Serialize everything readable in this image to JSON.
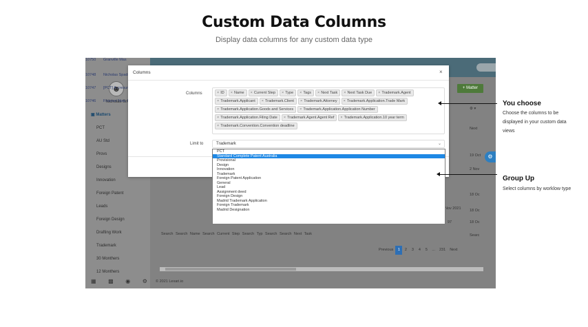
{
  "hero": {
    "title": "Custom Data Columns",
    "subtitle": "Display data columns for any custom data type"
  },
  "app": {
    "user_name": "Nicholas Smi",
    "sidebar": {
      "items": [
        {
          "label": "Matters",
          "active": true
        },
        {
          "label": "PCT"
        },
        {
          "label": "AU Std"
        },
        {
          "label": "Provs"
        },
        {
          "label": "Designs"
        },
        {
          "label": "Innovation"
        },
        {
          "label": "Foreign Patent"
        },
        {
          "label": "Leads"
        },
        {
          "label": "Foreign Design"
        },
        {
          "label": "Drafting Work"
        },
        {
          "label": "Trademark"
        },
        {
          "label": "30 Monthers"
        },
        {
          "label": "12 Monthers"
        }
      ]
    },
    "matter_button": "+ Matter",
    "right_column": [
      "⚙ ▾",
      "Next",
      "19 Oct",
      "2 Nov",
      "18 Oc",
      "Nov 2021",
      "18 Oc",
      "97",
      "18 Oc",
      "Searc"
    ],
    "table_rows": [
      {
        "id": "10750",
        "name": "Granville Mas"
      },
      {
        "id": "10748",
        "name": "Nicholas Spadre"
      },
      {
        "id": "10747",
        "name": "[PCT] A-cresum"
      },
      {
        "id": "10746",
        "name": "Finance Now, Pu"
      }
    ],
    "search_row": "Search    Search Name                                                                    Search Current Step    Search Typ    Search    Search Next Task",
    "pagination": [
      "Previous",
      "1",
      "2",
      "3",
      "4",
      "5",
      "...",
      "231",
      "Next"
    ],
    "pagination_active": "1",
    "copyright": "© 2021 Lexari.io"
  },
  "dialog": {
    "title": "Columns",
    "close": "×",
    "columns_label": "Columns",
    "limit_label": "Limit to",
    "limit_value": "Trademark",
    "tags": [
      "ID",
      "Name",
      "Current Step",
      "Type",
      "Tags",
      "Next Task",
      "Next Task Due",
      "Trademark.Agent",
      "Trademark.Applicant",
      "Trademark.Client",
      "Trademark.Attorney",
      "Trademark.Application.Trade Mark",
      "Trademark.Application.Goods and Services",
      "Trademark.Application.Application Number",
      "Trademark.Application.Filing Date",
      "Trademark.Agent.Agent Ref",
      "Trademark.Application.10 year term",
      "Trademark.Convention.Convention deadline"
    ]
  },
  "dropdown": {
    "selected": "Standard Complete Patent Australia",
    "options": [
      "PCT",
      "Standard Complete Patent Australia",
      "Provisional",
      "Design",
      "Innovation",
      "Trademark",
      "Foreign Patent Application",
      "General",
      "Lead",
      "Assignment deed",
      "Foreign Design",
      "Madrid Trademark Application",
      "Foreign Trademark",
      "Madrid Designation"
    ]
  },
  "annotations": [
    {
      "title": "You choose",
      "desc": "Choose the columns to be displayed in your custom data views"
    },
    {
      "title": "Group Up",
      "desc": "Select columns by worklow type"
    }
  ]
}
